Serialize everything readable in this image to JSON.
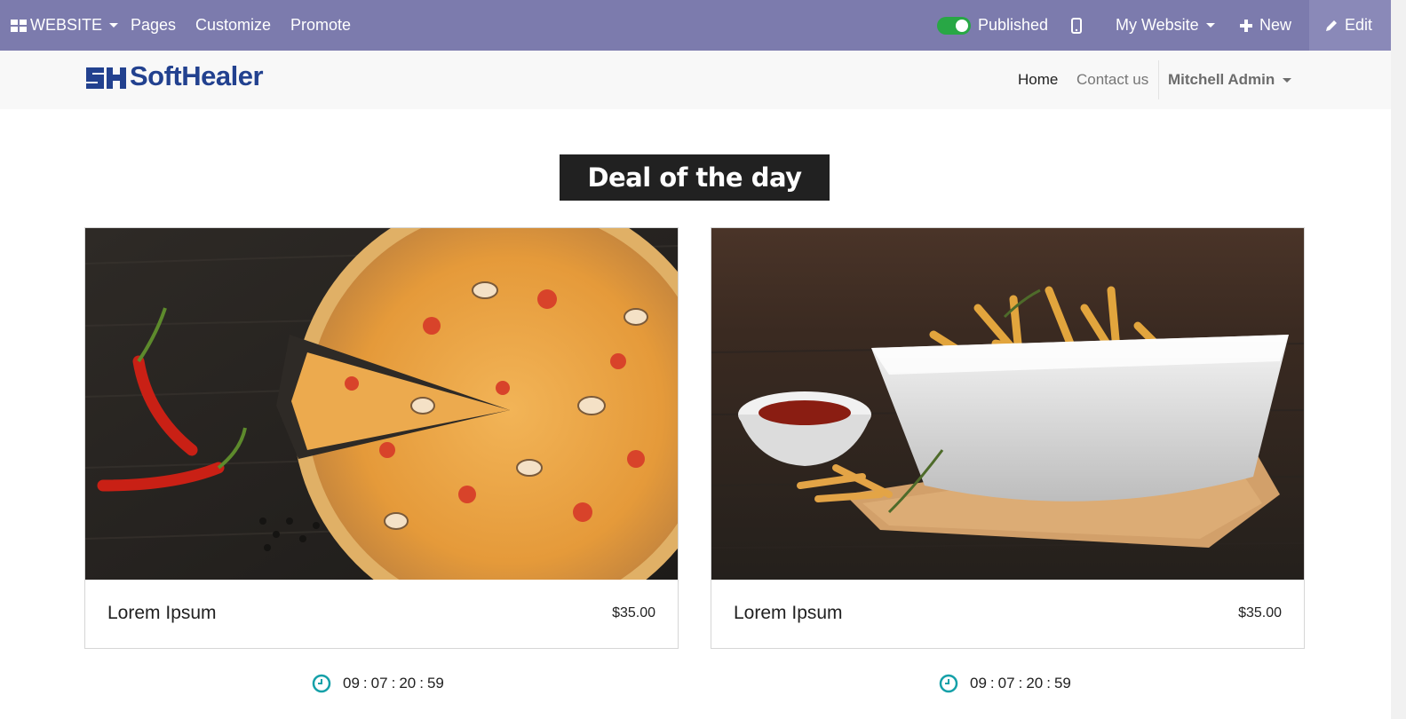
{
  "topbar": {
    "website_label": "WEBSITE",
    "pages": "Pages",
    "customize": "Customize",
    "promote": "Promote",
    "published": "Published",
    "my_website": "My Website",
    "new": "New",
    "edit": "Edit"
  },
  "header": {
    "logo_text": "SoftHealer",
    "nav": {
      "home": "Home",
      "contact": "Contact us",
      "user": "Mitchell Admin"
    }
  },
  "section": {
    "title": "Deal of the day"
  },
  "products": [
    {
      "name": "Lorem Ipsum",
      "price": "$35.00",
      "image": "pizza",
      "timer": {
        "days": "09",
        "hours": "07",
        "minutes": "20",
        "seconds": "59"
      }
    },
    {
      "name": "Lorem Ipsum",
      "price": "$35.00",
      "image": "french-fries",
      "timer": {
        "days": "09",
        "hours": "07",
        "minutes": "20",
        "seconds": "59"
      }
    }
  ],
  "colors": {
    "topbar": "#7c7bad",
    "toggle_on": "#28a745",
    "brand": "#22418f",
    "timer_icon": "#14a0a8",
    "title_bg": "#212121"
  }
}
